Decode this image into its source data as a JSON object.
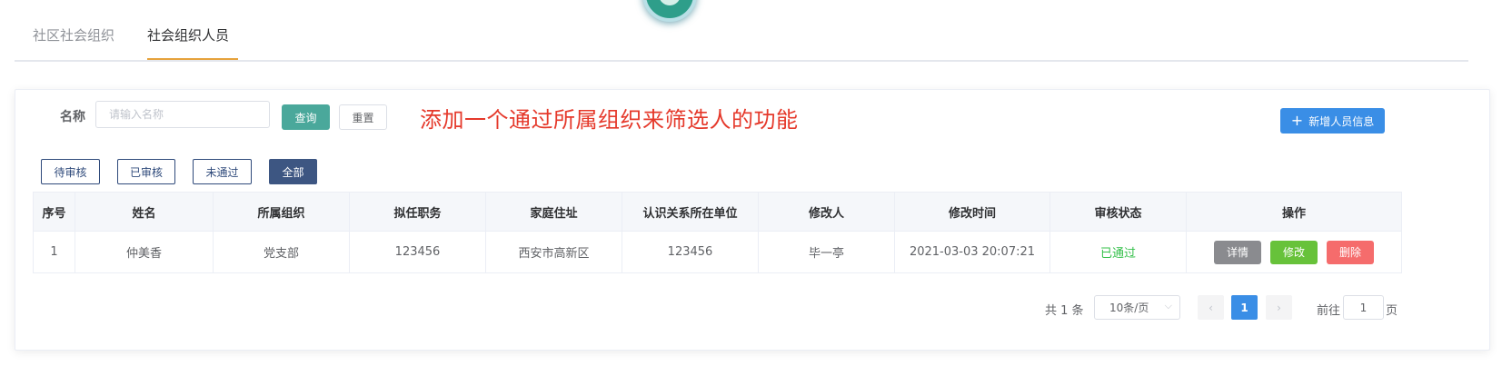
{
  "tabs": [
    {
      "label": "社区社会组织"
    },
    {
      "label": "社会组织人员"
    }
  ],
  "search": {
    "label": "名称",
    "placeholder": "请输入名称",
    "query_label": "查询",
    "reset_label": "重置"
  },
  "annotation": "添加一个通过所属组织来筛选人的功能",
  "add_button": {
    "icon": "plus-icon",
    "label": "新增人员信息"
  },
  "filters": [
    {
      "label": "待审核"
    },
    {
      "label": "已审核"
    },
    {
      "label": "未通过"
    },
    {
      "label": "全部",
      "active": true
    }
  ],
  "table": {
    "headers": [
      "序号",
      "姓名",
      "所属组织",
      "拟任职务",
      "家庭住址",
      "认识关系所在单位",
      "修改人",
      "修改时间",
      "审核状态",
      "操作"
    ],
    "rows": [
      {
        "index": "1",
        "name": "仲美香",
        "org": "党支部",
        "position": "123456",
        "address": "西安市高新区",
        "unit": "123456",
        "modifier": "毕一亭",
        "modified_time": "2021-03-03 20:07:21",
        "status": "已通过",
        "actions": {
          "detail": "详情",
          "edit": "修改",
          "delete": "删除"
        }
      }
    ]
  },
  "pagination": {
    "total": "共 1 条",
    "page_size": "10条/页",
    "current_page": "1",
    "goto_label": "前往",
    "goto_value": "1",
    "page_suffix": "页",
    "prev_icon": "chevron-left-icon",
    "next_icon": "chevron-right-icon"
  },
  "colors": {
    "accent_tab": "#e6a23c",
    "query_button": "#4aa89b",
    "primary": "#3a8ee6",
    "active_filter": "#3d5682",
    "status_approved": "#34c04a",
    "annotation": "#e5392b"
  }
}
